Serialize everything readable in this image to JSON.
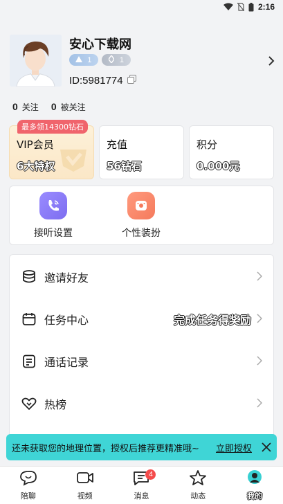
{
  "status_bar": {
    "time": "2:16"
  },
  "profile": {
    "name": "安心下载网",
    "level_badge": "1",
    "charm_badge": "1",
    "id_text": "ID:5981774"
  },
  "follow": {
    "following_count": "0",
    "following_label": "关注",
    "followers_count": "0",
    "followers_label": "被关注"
  },
  "cards": {
    "vip": {
      "promo": "最多领14300钻石",
      "title": "VIP会员",
      "value": "6大特权"
    },
    "recharge": {
      "title": "充值",
      "value": "56钻石"
    },
    "points": {
      "title": "积分",
      "value": "0.000元"
    }
  },
  "quick_actions": [
    {
      "label": "接听设置"
    },
    {
      "label": "个性装扮"
    }
  ],
  "menu": [
    {
      "label": "邀请好友"
    },
    {
      "label": "任务中心",
      "extra": "完成任务得奖励"
    },
    {
      "label": "通话记录"
    },
    {
      "label": "热榜"
    }
  ],
  "toast": {
    "message": "还未获取您的地理位置，授权后推荐更精准哦~",
    "action": "立即授权"
  },
  "tabs": [
    {
      "label": "陪聊"
    },
    {
      "label": "视频"
    },
    {
      "label": "消息",
      "badge": "4"
    },
    {
      "label": "动态"
    },
    {
      "label": "我的"
    }
  ],
  "colors": {
    "accent_purple": "#8a7cf6",
    "accent_orange": "#f7866a",
    "toast_bg": "#3fd5d6",
    "promo_red": "#f0646c",
    "badge_red": "#f44b4b"
  }
}
